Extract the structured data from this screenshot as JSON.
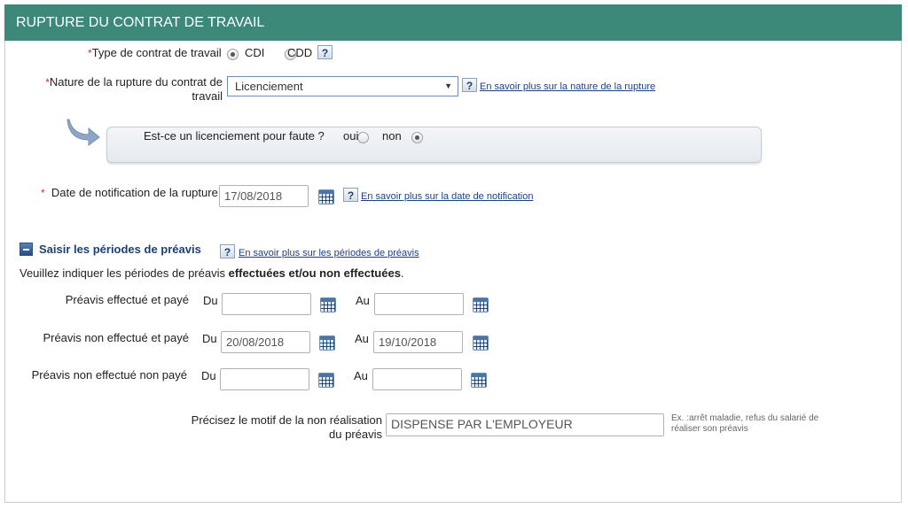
{
  "header": {
    "title": "RUPTURE DU CONTRAT DE TRAVAIL"
  },
  "contract_type": {
    "required_mark": "*",
    "label": "Type de contrat de travail",
    "options": [
      {
        "label": "CDI",
        "checked": true
      },
      {
        "label": "CDD",
        "checked": false
      }
    ],
    "help": "?"
  },
  "rupture_nature": {
    "required_mark": "*",
    "label_line1": "Nature de la rupture du contrat de",
    "label_line2": "travail",
    "selected": "Licenciement",
    "help": "?",
    "link": "En savoir plus sur la nature de la rupture"
  },
  "faute": {
    "question": "Est-ce un licenciement pour faute ?",
    "options": [
      {
        "label": "oui",
        "checked": false
      },
      {
        "label": "non",
        "checked": true
      }
    ]
  },
  "notification": {
    "required_mark": "*",
    "label": "Date de notification de la rupture",
    "value": "17/08/2018",
    "help": "?",
    "link": "En savoir plus sur la date de notification"
  },
  "preavis": {
    "section_title": "Saisir les périodes de préavis",
    "help": "?",
    "link": "En savoir plus sur les périodes de préavis",
    "instruction_prefix": "Veuillez indiquer les périodes de préavis ",
    "instruction_bold": "effectuées et/ou non effectuées",
    "instruction_suffix": ".",
    "du_label": "Du",
    "au_label": "Au",
    "rows": [
      {
        "label": "Préavis effectué et payé",
        "du": "",
        "au": ""
      },
      {
        "label": "Préavis non effectué et payé",
        "du": "20/08/2018",
        "au": "19/10/2018"
      },
      {
        "label": "Préavis non effectué non payé",
        "du": "",
        "au": ""
      }
    ],
    "motif_label_line1": "Précisez le motif de la non réalisation",
    "motif_label_line2": "du préavis",
    "motif_value": "DISPENSE PAR L'EMPLOYEUR",
    "motif_hint_line1": "Ex. :arrêt maladie, refus du salarié de",
    "motif_hint_line2": "réaliser son préavis"
  }
}
